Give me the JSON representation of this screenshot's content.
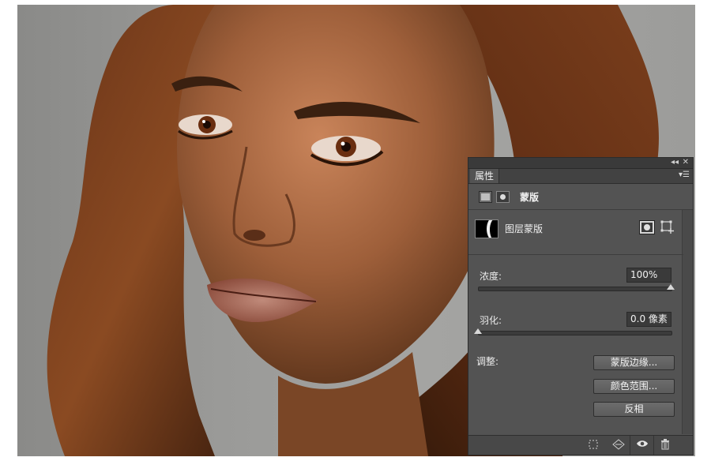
{
  "panel": {
    "collapse_icon": "double-chevron-icon",
    "close_icon": "close-icon",
    "tab_label": "属性",
    "tab_menu_icon": "panel-menu-icon",
    "header": {
      "pixel_mask_icon": "pixel-mask-icon",
      "vector_mask_icon": "vector-mask-icon",
      "title": "蒙版"
    },
    "layer": {
      "thumb_icon": "mask-thumbnail",
      "label": "图层蒙版",
      "add_pixel_mask_icon": "add-pixel-mask-icon",
      "add_vector_mask_icon": "add-vector-mask-icon"
    },
    "density": {
      "label": "浓度:",
      "value": "100%",
      "level": 1.0
    },
    "feather": {
      "label": "羽化:",
      "value": "0.0 像素",
      "level": 0.0
    },
    "adjust": {
      "label": "调整:",
      "buttons": [
        "蒙版边缘...",
        "颜色范围...",
        "反相"
      ]
    },
    "footer_icons": [
      "load-selection-icon",
      "apply-mask-icon",
      "eye-icon",
      "trash-icon"
    ]
  },
  "colors": {
    "panel_bg": "#535353",
    "panel_dark": "#3a3a3a",
    "text": "#e6e6e6"
  }
}
